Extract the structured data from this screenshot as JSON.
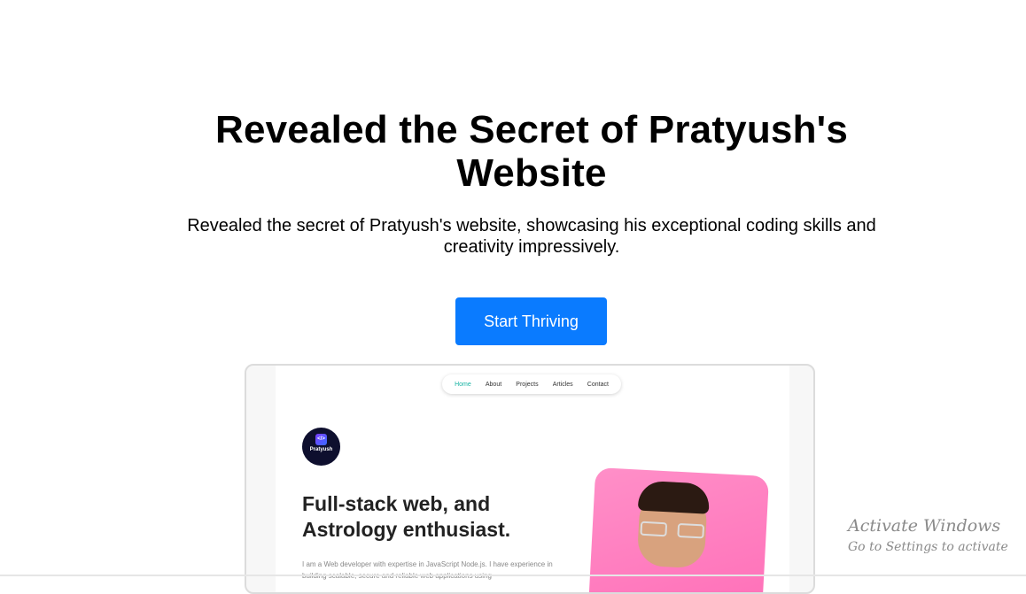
{
  "hero": {
    "headline_line1": "Revealed the Secret of Pratyush's",
    "headline_line2": "Website",
    "subhead_line1": "Revealed the secret of Pratyush's website, showcasing his exceptional coding skills and",
    "subhead_line2": "creativity impressively.",
    "cta_label": "Start Thriving",
    "cta_color": "#0a7bff"
  },
  "preview": {
    "nav": [
      "Home",
      "About",
      "Projects",
      "Articles",
      "Contact"
    ],
    "nav_active_color": "#17b3a3",
    "logo_text": "Pratyush",
    "logo_icon": "code-icon",
    "title_line1": "Full-stack web, and",
    "title_line2": "Astrology enthusiast.",
    "body": "I am a Web developer with expertise in JavaScript Node.js. I have experience in building scalable, secure and reliable web applications using"
  },
  "watermark": {
    "title": "Activate Windows",
    "subtitle": "Go to Settings to activate"
  }
}
